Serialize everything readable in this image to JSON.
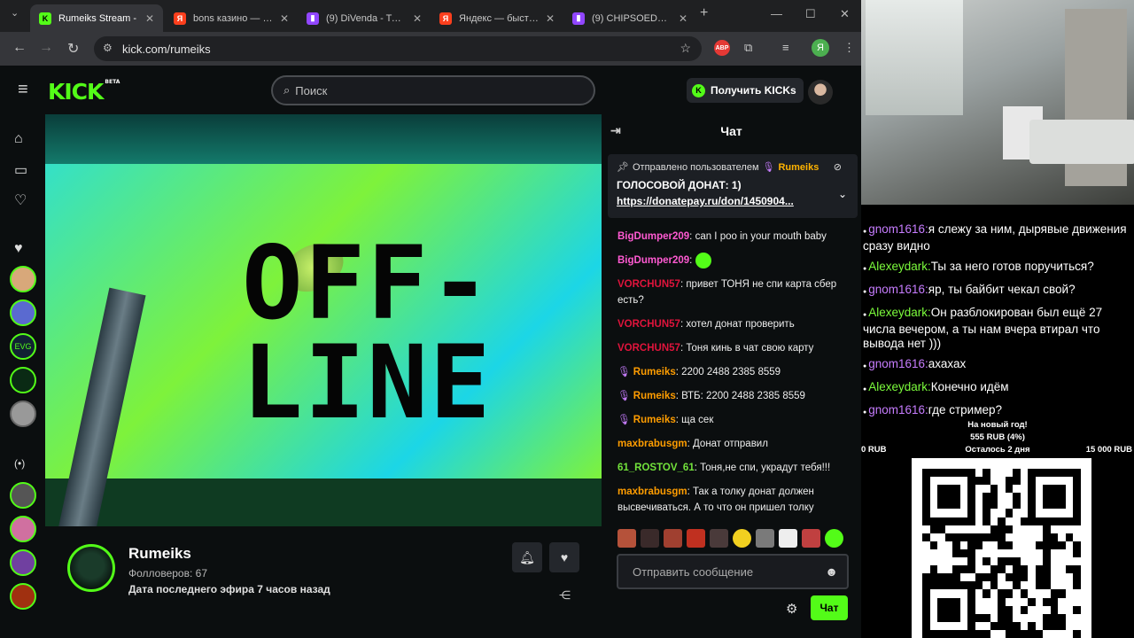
{
  "browser": {
    "tabs": [
      {
        "title": "Rumeiks Stream - ",
        "favicon": "kick-icon",
        "color": "#53fc18",
        "active": true
      },
      {
        "title": "bons казино — Ян",
        "favicon": "yandex-icon",
        "color": "#fc3f1d",
        "active": false
      },
      {
        "title": "(9) DiVenda - Twitc",
        "favicon": "twitch-icon",
        "color": "#9146ff",
        "active": false
      },
      {
        "title": "Яндекс — быстры",
        "favicon": "yandex-icon",
        "color": "#fc3f1d",
        "active": false
      },
      {
        "title": "(9) CHIPSOED196",
        "favicon": "twitch-icon",
        "color": "#9146ff",
        "active": false
      }
    ],
    "url": "kick.com/rumeiks",
    "profile_letter": "Я"
  },
  "kick": {
    "search_placeholder": "Поиск",
    "get_kicks_label": "Получить KICKs",
    "logo_text": "KICK",
    "logo_badge": "BETA",
    "offline_text": "OFF-\nLINE",
    "channel": {
      "name": "Rumeiks",
      "followers": "Фолловеров: 67",
      "last_stream": "Дата последнего эфира 7 часов назад"
    }
  },
  "chat": {
    "title": "Чат",
    "pinned": {
      "sent_by": "Отправлено пользователем",
      "user": "Rumeiks",
      "text": "ГОЛОСОВОЙ ДОНАТ: 1)",
      "link": "https://donatepay.ru/don/1450904..."
    },
    "messages": [
      {
        "user": "BigDumper209",
        "color": "#ff5ad2",
        "text": "can I poo in your mouth baby",
        "emote": false
      },
      {
        "user": "BigDumper209",
        "color": "#ff5ad2",
        "text": "",
        "emote": true
      },
      {
        "user": "VORCHUN57",
        "color": "#e0143c",
        "text": "привет ТОНЯ не спи карта сбер есть?",
        "emote": false
      },
      {
        "user": "VORCHUN57",
        "color": "#e0143c",
        "text": "хотел донат проверить",
        "emote": false
      },
      {
        "user": "VORCHUN57",
        "color": "#e0143c",
        "text": "Тоня кинь в чат свою карту",
        "emote": false
      },
      {
        "user": "Rumeiks",
        "color": "#ff9d00",
        "text": "2200 2488 2385 8559",
        "emote": false,
        "mic": true
      },
      {
        "user": "Rumeiks",
        "color": "#ff9d00",
        "text": "ВТБ: 2200 2488 2385 8559",
        "emote": false,
        "mic": true
      },
      {
        "user": "Rumeiks",
        "color": "#ff9d00",
        "text": "ща сек",
        "emote": false,
        "mic": true
      },
      {
        "user": "maxbrabusgm",
        "color": "#ff9d00",
        "text": "Донат отправил",
        "emote": false
      },
      {
        "user": "61_ROSTOV_61",
        "color": "#72e23b",
        "text": "Тоня,не спи, украдут тебя!!!",
        "emote": false
      },
      {
        "user": "maxbrabusgm",
        "color": "#ff9d00",
        "text": "Так а толку донат должен высвечиваться. А то что он пришел толку",
        "emote": false
      }
    ],
    "input_placeholder": "Отправить сообщение",
    "send_label": "Чат"
  },
  "overlay": {
    "chat": [
      {
        "user": "gnom1616",
        "color": "#c77dff",
        "text": "я слежу за ним, дырявые движения сразу видно"
      },
      {
        "user": "Alexeydark",
        "color": "#7cfc3c",
        "text": "Ты за него готов поручиться?"
      },
      {
        "user": "gnom1616",
        "color": "#c77dff",
        "text": "яр, ты байбит чекал свой?"
      },
      {
        "user": "Alexeydark",
        "color": "#7cfc3c",
        "text": "Он разблокирован был ещё 27 числа вечером, а ты нам вчера втирал что вывода нет )))"
      },
      {
        "user": "gnom1616",
        "color": "#c77dff",
        "text": "ахахах"
      },
      {
        "user": "Alexeydark",
        "color": "#7cfc3c",
        "text": "Конечно идём"
      },
      {
        "user": "gnom1616",
        "color": "#c77dff",
        "text": "где стример?"
      }
    ],
    "goal": {
      "title": "На новый год!",
      "progress": "555 RUB (4%)",
      "progress_fraction": 0.04,
      "min": "0 RUB",
      "remaining": "Осталось 2 дня",
      "max": "15 000 RUB"
    }
  },
  "colors": {
    "brand": "#53fc18",
    "bg": "#0b0e0f"
  }
}
